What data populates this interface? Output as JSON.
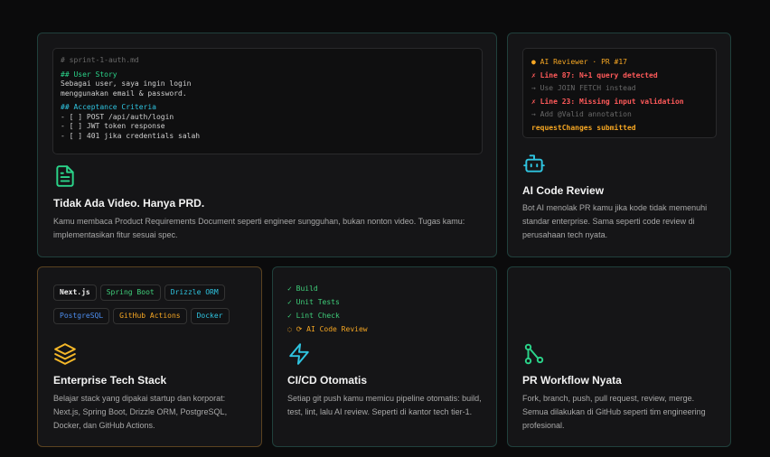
{
  "colors": {
    "green": "#2bd48a",
    "cyan": "#2fc4e0",
    "orange": "#f5a623",
    "red": "#ff5a5a"
  },
  "cards": {
    "prd": {
      "code": {
        "filename": "# sprint-1-auth.md",
        "story_heading": "## User Story",
        "story_line1": "Sebagai user, saya ingin login",
        "story_line2": "menggunakan email & password.",
        "criteria_heading": "## Acceptance Criteria",
        "criteria": [
          "- [ ] POST /api/auth/login",
          "- [ ] JWT token response",
          "- [ ] 401 jika credentials salah"
        ]
      },
      "icon": "document-icon",
      "title": "Tidak Ada Video. Hanya PRD.",
      "desc": "Kamu membaca Product Requirements Document seperti engineer sungguhan, bukan nonton video. Tugas kamu: implementasikan fitur sesuai spec."
    },
    "ai_review": {
      "code": {
        "header": "● AI Reviewer · PR #17",
        "line1": "✗ Line 87: N+1 query detected",
        "hint1": "→ Use JOIN FETCH instead",
        "line2": "✗ Line 23: Missing input validation",
        "hint2": "→ Add @Valid annotation",
        "result": "requestChanges submitted"
      },
      "icon": "bot-icon",
      "title": "AI Code Review",
      "desc": "Bot AI menolak PR kamu jika kode tidak memenuhi standar enterprise. Sama seperti code review di perusahaan tech nyata."
    },
    "stack": {
      "pills": [
        {
          "label": "Next.js",
          "color": "#f2f2f2"
        },
        {
          "label": "Spring Boot",
          "color": "#3fce7a"
        },
        {
          "label": "Drizzle ORM",
          "color": "#2fc4e0"
        },
        {
          "label": "PostgreSQL",
          "color": "#4d8ef0"
        },
        {
          "label": "GitHub Actions",
          "color": "#f5a623"
        },
        {
          "label": "Docker",
          "color": "#2fc4e0"
        }
      ],
      "icon": "layers-icon",
      "title": "Enterprise Tech Stack",
      "desc": "Belajar stack yang dipakai startup dan korporat: Next.js, Spring Boot, Drizzle ORM, PostgreSQL, Docker, dan GitHub Actions."
    },
    "cicd": {
      "steps": [
        "✓ Build",
        "✓ Unit Tests",
        "✓ Lint Check",
        "◌ ⟳ AI Code Review"
      ],
      "icon": "lightning-icon",
      "title": "CI/CD Otomatis",
      "desc": "Setiap git push kamu memicu pipeline otomatis: build, test, lint, lalu AI review. Seperti di kantor tech tier-1."
    },
    "workflow": {
      "icon": "git-branch-icon",
      "title": "PR Workflow Nyata",
      "desc": "Fork, branch, push, pull request, review, merge. Semua dilakukan di GitHub seperti tim engineering profesional."
    }
  }
}
